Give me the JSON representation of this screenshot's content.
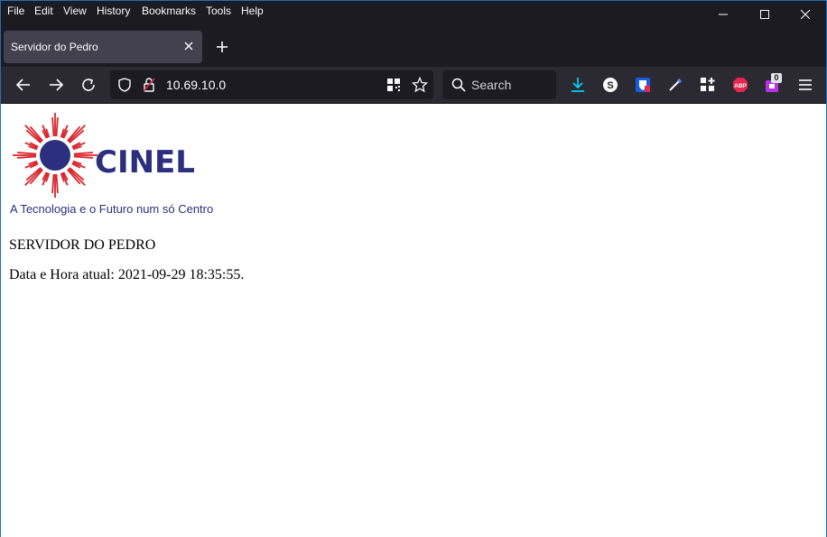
{
  "menu": {
    "file": "File",
    "edit": "Edit",
    "view": "View",
    "history": "History",
    "bookmarks": "Bookmarks",
    "tools": "Tools",
    "help": "Help"
  },
  "tab": {
    "title": "Servidor do Pedro"
  },
  "navbar": {
    "url": "10.69.10.0",
    "search_label": "Search",
    "extension_badge": "0"
  },
  "page": {
    "logo_text": "CINEL",
    "tagline": "A Tecnologia e o Futuro num só Centro",
    "heading": "SERVIDOR DO PEDRO",
    "datetime_line": "Data e Hora atual: 2021-09-29 18:35:55."
  },
  "colors": {
    "logo_blue": "#2c2f7e",
    "logo_red": "#d9252c",
    "chrome_bg": "#1c1b22",
    "toolbar_bg": "#2b2a33"
  },
  "icons": [
    "back-icon",
    "forward-icon",
    "reload-icon",
    "shield-icon",
    "lock-icon",
    "qr-icon",
    "star-icon",
    "search-icon",
    "download-icon",
    "skype-icon",
    "bitwarden-icon",
    "eyedropper-icon",
    "extensions-icon",
    "adblock-icon",
    "extension-icon",
    "menu-icon"
  ]
}
